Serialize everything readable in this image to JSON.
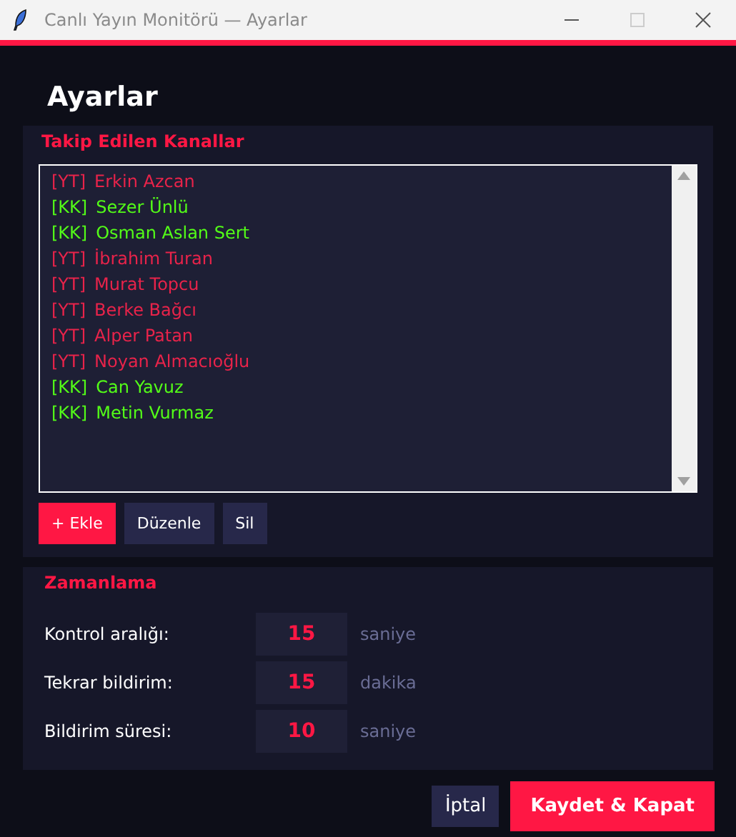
{
  "window": {
    "title": "Canlı Yayın Monitörü — Ayarlar"
  },
  "heading": "Ayarlar",
  "channels_panel": {
    "title": "Takip Edilen Kanallar",
    "channels": [
      {
        "platform": "[YT]",
        "name": "Erkin Azcan",
        "color": "#e8234a"
      },
      {
        "platform": "[KK]",
        "name": "Sezer Ünlü",
        "color": "#53fc18"
      },
      {
        "platform": "[KK]",
        "name": "Osman Aslan Sert",
        "color": "#53fc18"
      },
      {
        "platform": "[YT]",
        "name": "İbrahim Turan",
        "color": "#e8234a"
      },
      {
        "platform": "[YT]",
        "name": "Murat Topcu",
        "color": "#e8234a"
      },
      {
        "platform": "[YT]",
        "name": "Berke Bağcı",
        "color": "#e8234a"
      },
      {
        "platform": "[YT]",
        "name": "Alper Patan",
        "color": "#e8234a"
      },
      {
        "platform": "[YT]",
        "name": "Noyan Almacıoğlu",
        "color": "#e8234a"
      },
      {
        "platform": "[KK]",
        "name": "Can Yavuz",
        "color": "#53fc18"
      },
      {
        "platform": "[KK]",
        "name": "Metin Vurmaz",
        "color": "#53fc18"
      }
    ],
    "buttons": [
      {
        "label": "+ Ekle",
        "kind": "primary"
      },
      {
        "label": "Düzenle",
        "kind": "secondary"
      },
      {
        "label": "Sil",
        "kind": "secondary"
      }
    ]
  },
  "timing_panel": {
    "title": "Zamanlama",
    "rows": [
      {
        "label": "Kontrol aralığı:",
        "value": "15",
        "unit": "saniye"
      },
      {
        "label": "Tekrar bildirim:",
        "value": "15",
        "unit": "dakika"
      },
      {
        "label": "Bildirim süresi:",
        "value": "10",
        "unit": "saniye"
      }
    ]
  },
  "footer_buttons": [
    {
      "label": "İptal",
      "kind": "secondary"
    },
    {
      "label": "Kaydet & Kapat",
      "kind": "primary"
    }
  ]
}
